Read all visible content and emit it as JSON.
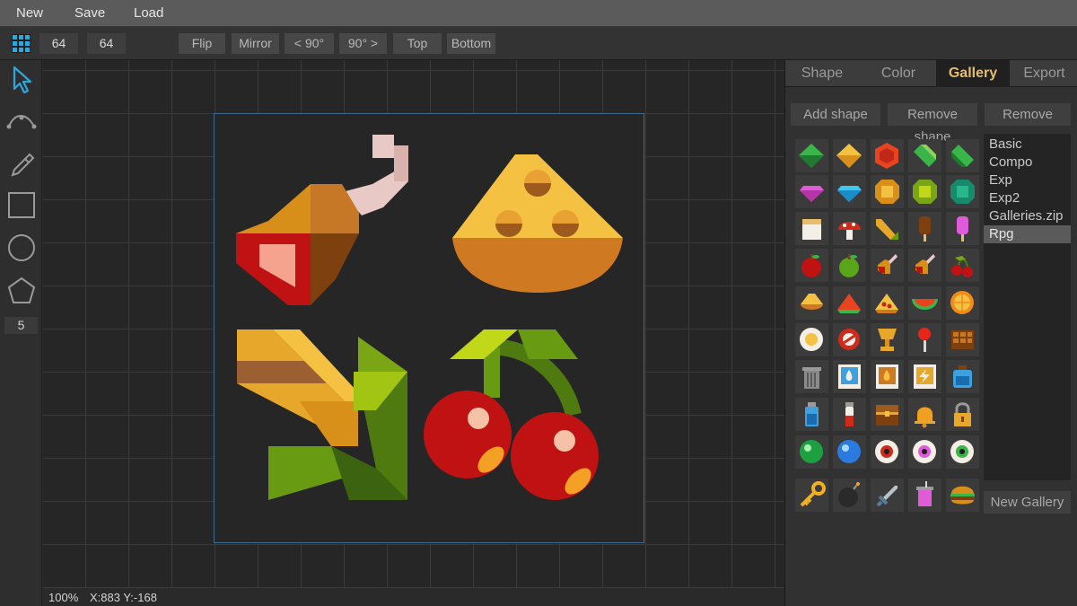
{
  "menu": {
    "new": "New",
    "save": "Save",
    "load": "Load"
  },
  "toolbar": {
    "width": "64",
    "height": "64",
    "flip": "Flip",
    "mirror": "Mirror",
    "rot_left": "< 90°",
    "rot_right": "90° >",
    "top": "Top",
    "bottom": "Bottom"
  },
  "tools": {
    "sides": "5"
  },
  "status": {
    "zoom": "100%",
    "coords": "X:883 Y:-168"
  },
  "tabs": [
    "Shape",
    "Color",
    "Gallery",
    "Export"
  ],
  "active_tab": "Gallery",
  "gallery": {
    "add": "Add shape",
    "remove_shape": "Remove shape",
    "remove": "Remove",
    "new_gallery": "New Gallery",
    "galleries": [
      "Basic",
      "Compo",
      "Exp",
      "Exp2",
      "Galleries.zip",
      "Rpg"
    ],
    "selected": "Rpg"
  },
  "colors": {
    "accent": "#e7bd6c",
    "selection": "#3e6a8e",
    "cursor": "#2aa8e0"
  },
  "icons": [
    "grid-icon",
    "cursor-icon",
    "bezier-icon",
    "eyedropper-icon",
    "rectangle-icon",
    "circle-icon",
    "pentagon-icon"
  ]
}
